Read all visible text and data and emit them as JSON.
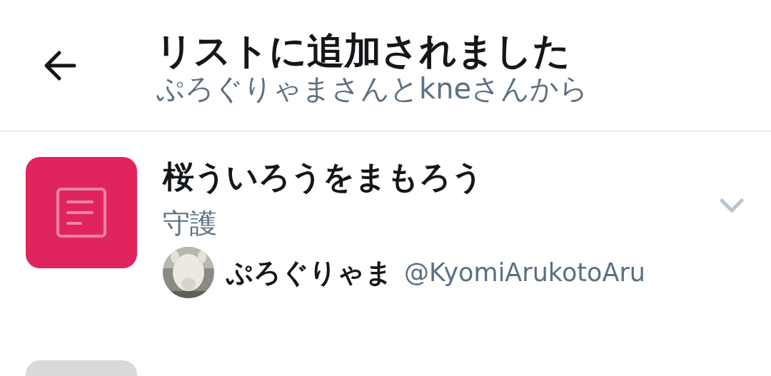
{
  "header": {
    "title": "リストに追加されました",
    "subtitle": "ぷろぐりゃまさんとkneさんから"
  },
  "lists": [
    {
      "color": "#e0245e",
      "title": "桜ういろうをまもろう",
      "description": "守護",
      "owner_name": "ぷろぐりゃま",
      "owner_handle": "@KyomiArukotoAru"
    },
    {
      "color": "#d9d9d9"
    }
  ]
}
